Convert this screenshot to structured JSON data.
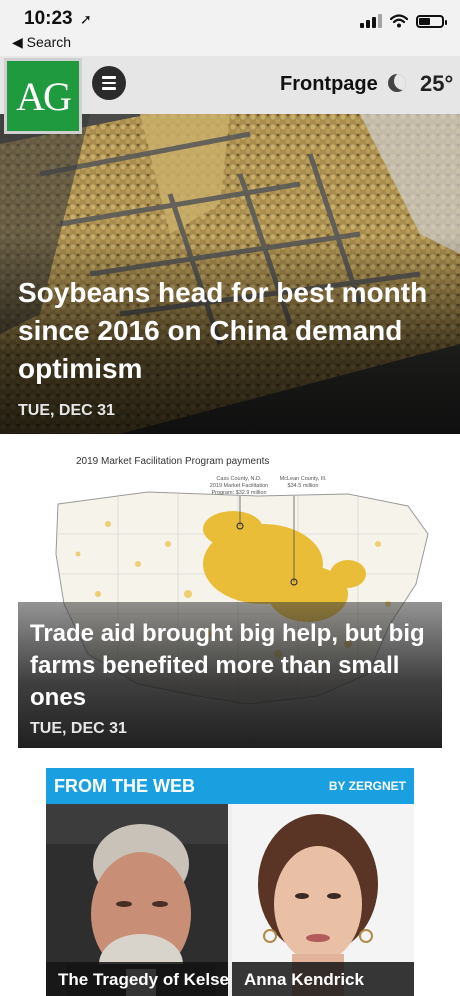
{
  "status_bar": {
    "time": "10:23",
    "back_label": "◀ Search"
  },
  "header": {
    "logo_text": "AG",
    "section_title": "Frontpage",
    "weather_icon": "moon-icon",
    "temperature": "25°"
  },
  "stories": [
    {
      "title": "Soybeans head for best month since 2016 on China demand optimism",
      "date": "TUE, DEC 31"
    },
    {
      "title": "Trade aid brought big help, but big farms benefited more than small ones",
      "date": "TUE, DEC 31",
      "image": {
        "map_title": "2019 Market Facilitation Program payments",
        "note_left": "Cass County, N.D.\n2019 Market Facilitation\nProgram: $32.9 million",
        "note_right": "McLean County, Ill.\n$34.5 million"
      }
    }
  ],
  "from_the_web": {
    "header": "FROM THE WEB",
    "by": "BY ZERGNET",
    "items": [
      {
        "caption": "The Tragedy of Kelsey"
      },
      {
        "caption": "Anna Kendrick"
      }
    ]
  },
  "colors": {
    "logo_green": "#1f9a3f",
    "zergnet_blue": "#1aa0e0",
    "map_dots": "#e8b824"
  }
}
